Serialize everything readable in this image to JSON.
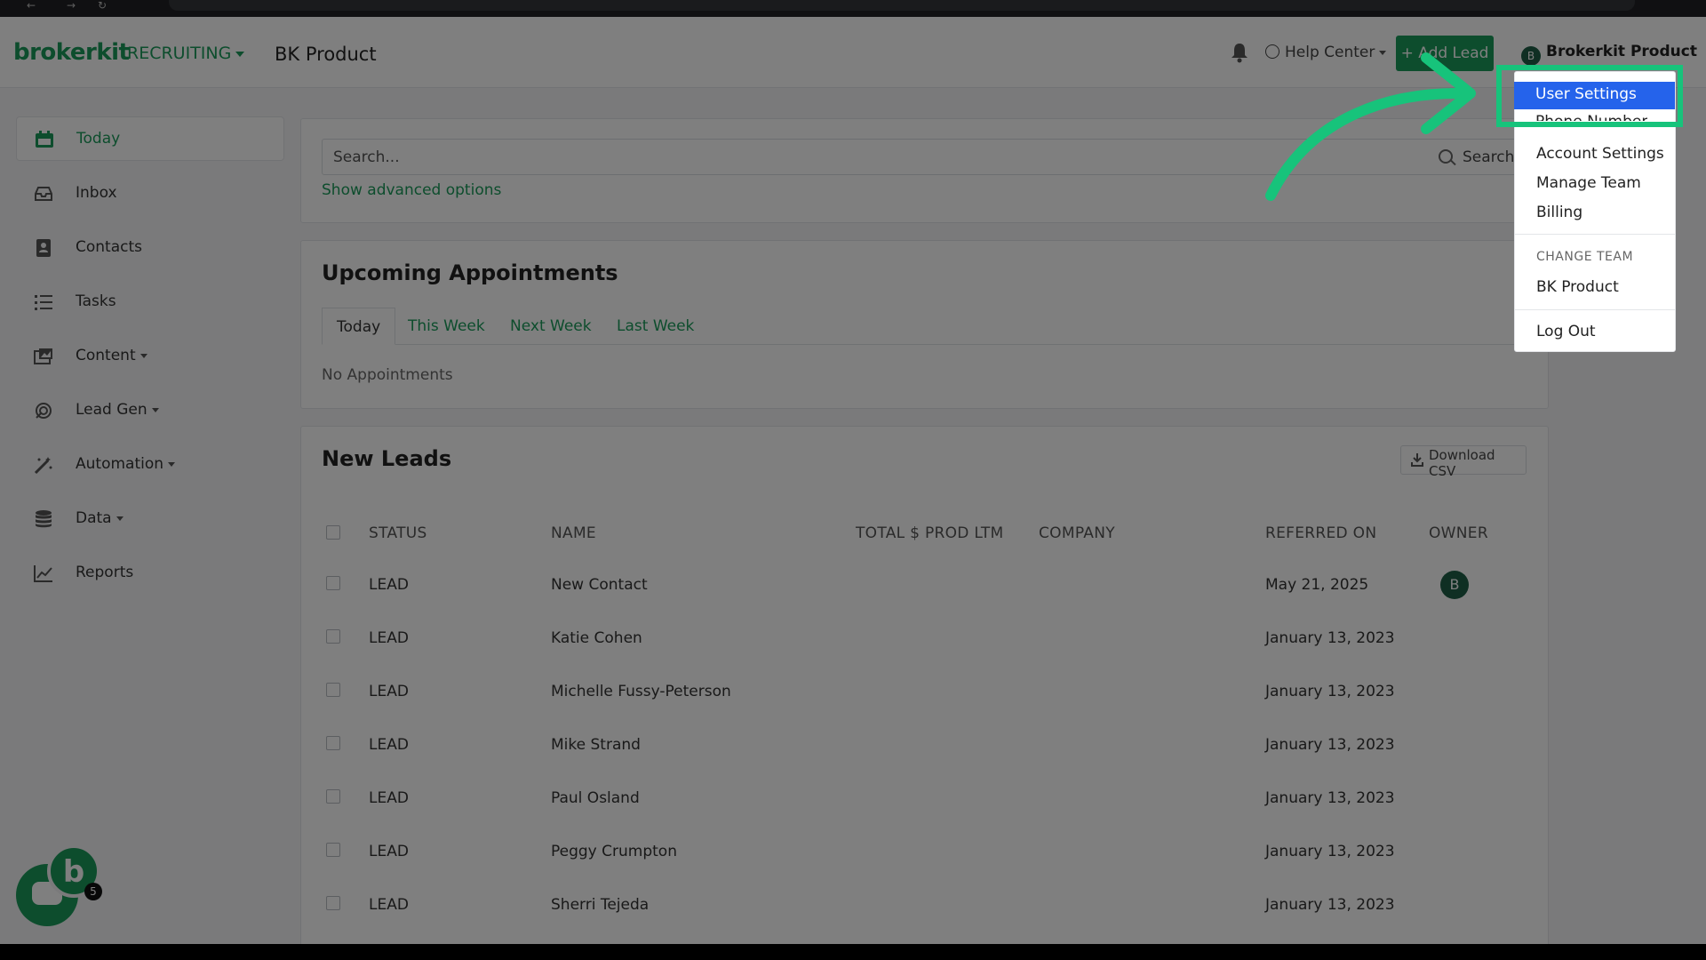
{
  "brand": {
    "logo": "brokerkit",
    "module": "RECRUITING",
    "team_title": "BK Product"
  },
  "header": {
    "help_center": "Help Center",
    "add_lead": "+ Add Lead",
    "account_name": "Brokerkit Product",
    "account_initial": "B"
  },
  "sidebar": {
    "items": [
      {
        "label": "Today",
        "icon": "calendar-icon"
      },
      {
        "label": "Inbox",
        "icon": "inbox-icon"
      },
      {
        "label": "Contacts",
        "icon": "contacts-book-icon"
      },
      {
        "label": "Tasks",
        "icon": "task-list-icon"
      },
      {
        "label": "Content",
        "icon": "content-icon"
      },
      {
        "label": "Lead Gen",
        "icon": "lead-gen-icon"
      },
      {
        "label": "Automation",
        "icon": "magic-wand-icon"
      },
      {
        "label": "Data",
        "icon": "database-icon"
      },
      {
        "label": "Reports",
        "icon": "line-chart-icon"
      }
    ]
  },
  "search": {
    "placeholder": "Search...",
    "button": "Search",
    "advanced": "Show advanced options"
  },
  "appointments": {
    "title": "Upcoming Appointments",
    "tabs": [
      "Today",
      "This Week",
      "Next Week",
      "Last Week"
    ],
    "empty": "No Appointments"
  },
  "leads": {
    "title": "New Leads",
    "download": "Download CSV",
    "columns": [
      "STATUS",
      "NAME",
      "TOTAL $ PROD LTM",
      "COMPANY",
      "REFERRED ON",
      "OWNER"
    ],
    "rows": [
      {
        "status": "LEAD",
        "name": "New Contact",
        "referred_on": "May 21, 2025",
        "owner": "B"
      },
      {
        "status": "LEAD",
        "name": "Katie Cohen",
        "referred_on": "January 13, 2023",
        "owner": ""
      },
      {
        "status": "LEAD",
        "name": "Michelle Fussy-Peterson",
        "referred_on": "January 13, 2023",
        "owner": ""
      },
      {
        "status": "LEAD",
        "name": "Mike Strand",
        "referred_on": "January 13, 2023",
        "owner": ""
      },
      {
        "status": "LEAD",
        "name": "Paul Osland",
        "referred_on": "January 13, 2023",
        "owner": ""
      },
      {
        "status": "LEAD",
        "name": "Peggy Crumpton",
        "referred_on": "January 13, 2023",
        "owner": ""
      },
      {
        "status": "LEAD",
        "name": "Sherri Tejeda",
        "referred_on": "January 13, 2023",
        "owner": ""
      }
    ]
  },
  "user_menu": {
    "active": "User Settings",
    "partial": "Phone Number",
    "items": [
      "Account Settings",
      "Manage Team",
      "Billing"
    ],
    "change_team_header": "CHANGE TEAM",
    "team": "BK Product",
    "logout": "Log Out"
  },
  "chat_widget": {
    "logo_letter": "b",
    "badge": "5"
  },
  "colors": {
    "brand_green": "#1a9b5a",
    "highlight": "#17c37b",
    "menu_active": "#2563eb",
    "dim_overlay": "rgba(0,0,0,0.5)"
  }
}
